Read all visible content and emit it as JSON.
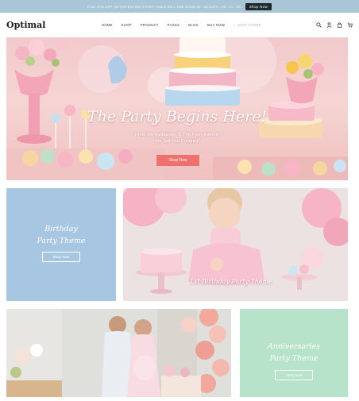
{
  "announcement": {
    "text": "FLAT 20% OFF ON THE ENTIRE STORE | SALE WILL END SOON IN : 98 DAYS : 05 : 21 : 35",
    "button": "Shop Now"
  },
  "header": {
    "logo": "Optimal",
    "nav": [
      "HOME",
      "SHOP",
      "PRODUCT",
      "PAGES",
      "BLOG",
      "BUY NOW",
      "+ SHOP STORE"
    ],
    "icons": [
      "search-icon",
      "user-icon",
      "bag-icon",
      "cart-icon"
    ]
  },
  "hero": {
    "title": "The Party Begins Here!",
    "subtitle_line1": "From the Invitations To The Party Favors,",
    "subtitle_line2": "We Got You Covered!",
    "button": "Shop Now"
  },
  "birthday_panel": {
    "title_line1": "Birthday",
    "title_line2": "Party Theme",
    "button": "Shop Now"
  },
  "first_birthday": {
    "caption": "1st Birthday Party Theme"
  },
  "anniversary_panel": {
    "title_line1": "Anniversaries",
    "title_line2": "Party Theme",
    "button": "Shop Now"
  },
  "colors": {
    "announcement_bg": "#a9c6d6",
    "accent": "#f0706e",
    "birthday_panel": "#a7c6e2",
    "anniversary_panel": "#b6e3c9"
  }
}
